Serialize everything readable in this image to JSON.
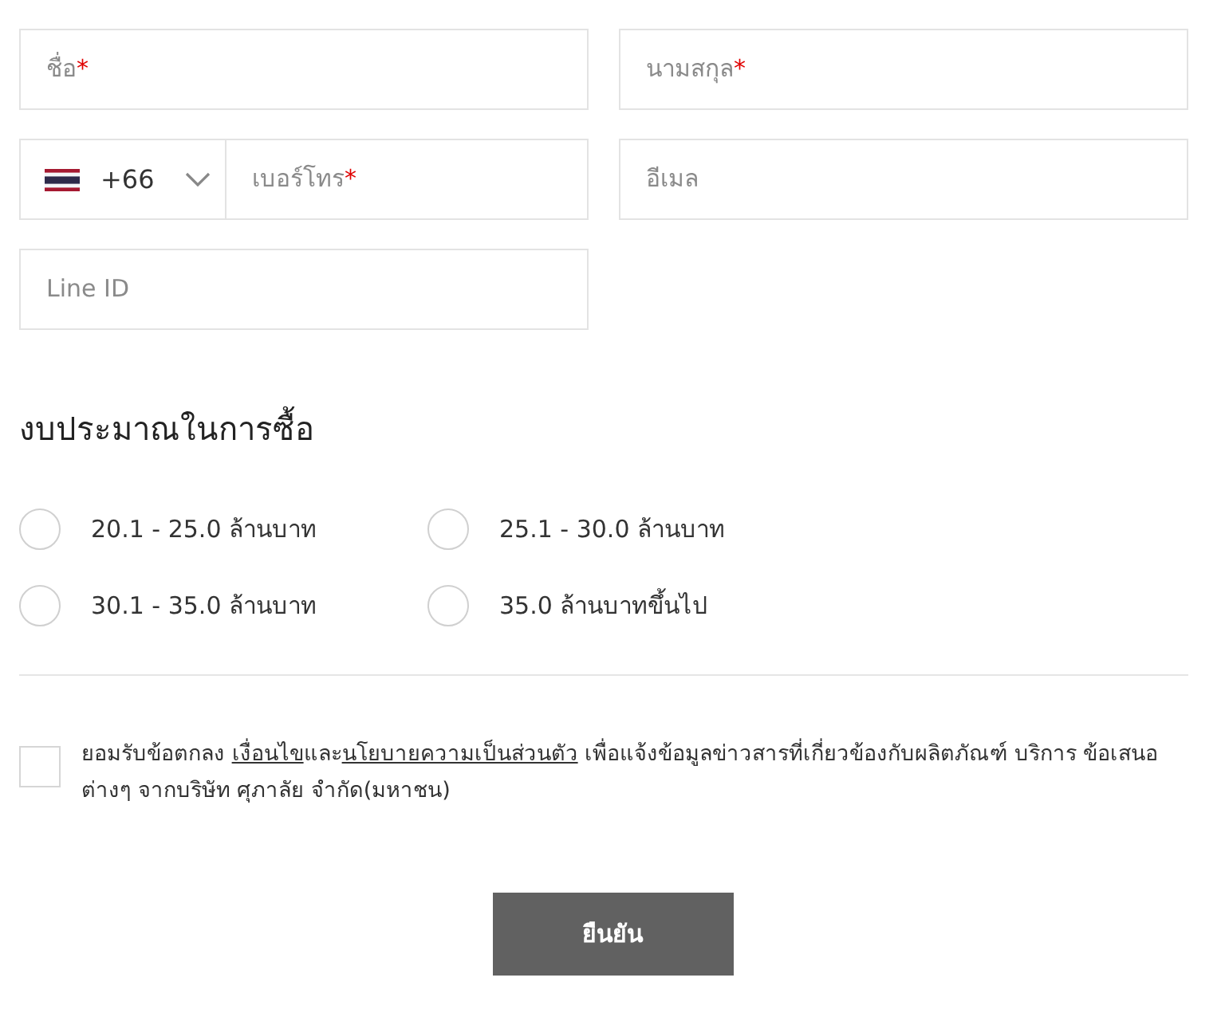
{
  "fields": [
    {
      "kind": "text",
      "placeholder": "ชื่อ",
      "required_mark": "*"
    },
    {
      "kind": "text",
      "placeholder": "นามสกุล",
      "required_mark": "*"
    },
    {
      "kind": "phone",
      "country_code": "+66",
      "placeholder": "เบอร์โทร",
      "required_mark": "*"
    },
    {
      "kind": "text",
      "placeholder": "อีเมล"
    },
    {
      "kind": "text",
      "placeholder": "Line ID"
    }
  ],
  "budget": {
    "title": "งบประมาณในการซื้อ",
    "options": [
      {
        "label": "20.1 - 25.0 ล้านบาท",
        "selected": false
      },
      {
        "label": "25.1 - 30.0 ล้านบาท",
        "selected": false
      },
      {
        "label": "30.1 - 35.0 ล้านบาท",
        "selected": false
      },
      {
        "label": "35.0 ล้านบาทขึ้นไป",
        "selected": false
      }
    ]
  },
  "consent": {
    "checked": false,
    "parts": [
      {
        "kind": "text",
        "text": "ยอมรับข้อตกลง "
      },
      {
        "kind": "link",
        "text": "เงื่อนไข"
      },
      {
        "kind": "text",
        "text": "และ"
      },
      {
        "kind": "link",
        "text": "นโยบายความเป็นส่วนตัว"
      },
      {
        "kind": "text",
        "text": " เพื่อแจ้งข้อมูลข่าวสารที่เกี่ยวข้องกับผลิตภัณฑ์ บริการ ข้อเสนอต่างๆ จากบริษัท ศุภาลัย จำกัด(มหาชน)"
      }
    ]
  },
  "submit": {
    "label": "ยืนยัน"
  }
}
